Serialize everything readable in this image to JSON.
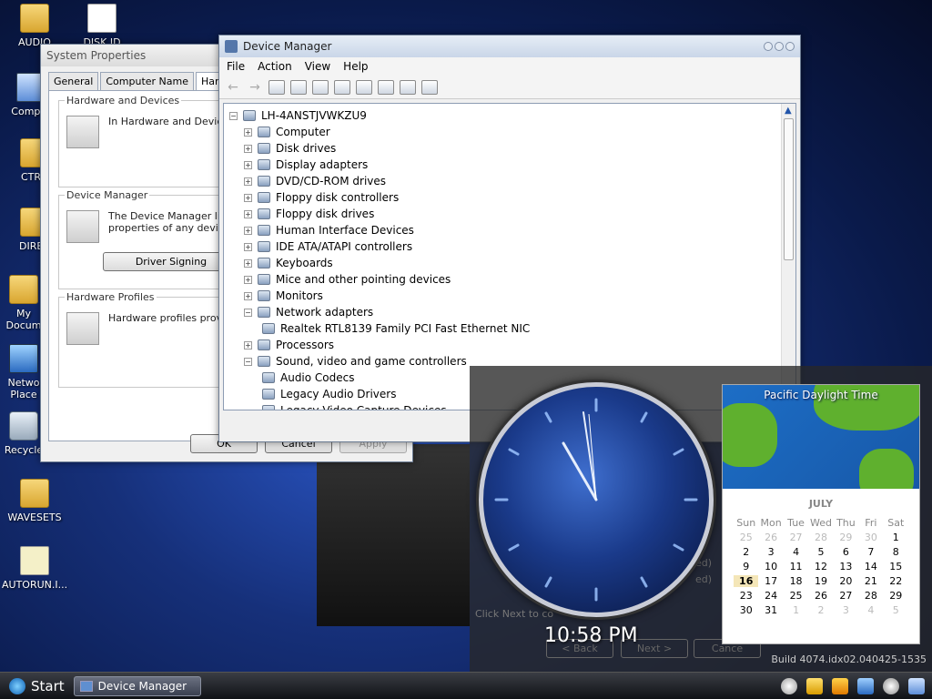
{
  "desktop": {
    "icons": [
      {
        "label": "AUDIO",
        "type": "folder"
      },
      {
        "label": "DISK ID",
        "type": "doc"
      },
      {
        "label": "Comput",
        "type": "computer"
      },
      {
        "label": "CTRU",
        "type": "folder"
      },
      {
        "label": "DIREC",
        "type": "folder"
      },
      {
        "label": "My Docum",
        "type": "folder"
      },
      {
        "label": "Netwo Place",
        "type": "network"
      },
      {
        "label": "Recycle",
        "type": "recycle"
      },
      {
        "label": "WAVESETS",
        "type": "folder"
      },
      {
        "label": "AUTORUN.I...",
        "type": "doc"
      }
    ]
  },
  "system_properties": {
    "title": "System Properties",
    "tabs": [
      "General",
      "Computer Name",
      "Hardwar"
    ],
    "groups": {
      "hardware_devices": {
        "label": "Hardware and Devices",
        "text": "In Hardware and Device to this computer."
      },
      "device_manager": {
        "label": "Device Manager",
        "text": "The Device Manager lis on your computer. Use properties of any device",
        "button": "Driver Signing"
      },
      "hardware_profiles": {
        "label": "Hardware Profiles",
        "text": "Hardware profiles provi different hardware conf"
      }
    },
    "buttons": {
      "ok": "OK",
      "cancel": "Cancel",
      "apply": "Apply"
    }
  },
  "device_manager": {
    "title": "Device Manager",
    "menu": [
      "File",
      "Action",
      "View",
      "Help"
    ],
    "root": "LH-4ANSTJVWKZU9",
    "tree": [
      {
        "label": "Computer",
        "expanded": false,
        "level": 1
      },
      {
        "label": "Disk drives",
        "expanded": false,
        "level": 1
      },
      {
        "label": "Display adapters",
        "expanded": false,
        "level": 1
      },
      {
        "label": "DVD/CD-ROM drives",
        "expanded": false,
        "level": 1
      },
      {
        "label": "Floppy disk controllers",
        "expanded": false,
        "level": 1
      },
      {
        "label": "Floppy disk drives",
        "expanded": false,
        "level": 1
      },
      {
        "label": "Human Interface Devices",
        "expanded": false,
        "level": 1
      },
      {
        "label": "IDE ATA/ATAPI controllers",
        "expanded": false,
        "level": 1
      },
      {
        "label": "Keyboards",
        "expanded": false,
        "level": 1
      },
      {
        "label": "Mice and other pointing devices",
        "expanded": false,
        "level": 1
      },
      {
        "label": "Monitors",
        "expanded": false,
        "level": 1
      },
      {
        "label": "Network adapters",
        "expanded": true,
        "level": 1
      },
      {
        "label": "Realtek RTL8139 Family PCI Fast Ethernet NIC",
        "level": 2
      },
      {
        "label": "Processors",
        "expanded": false,
        "level": 1
      },
      {
        "label": "Sound, video and game controllers",
        "expanded": true,
        "level": 1
      },
      {
        "label": "Audio Codecs",
        "level": 2
      },
      {
        "label": "Legacy Audio Drivers",
        "level": 2
      },
      {
        "label": "Legacy Video Capture Devices",
        "level": 2
      }
    ]
  },
  "gadgets": {
    "clock_time": "10:58 PM",
    "calendar": {
      "timezone": "Pacific Daylight Time",
      "month": "JULY",
      "weekdays": [
        "Sun",
        "Mon",
        "Tue",
        "Wed",
        "Thu",
        "Fri",
        "Sat"
      ],
      "days": [
        [
          "25",
          "26",
          "27",
          "28",
          "29",
          "30",
          "1"
        ],
        [
          "2",
          "3",
          "4",
          "5",
          "6",
          "7",
          "8"
        ],
        [
          "9",
          "10",
          "11",
          "12",
          "13",
          "14",
          "15"
        ],
        [
          "16",
          "17",
          "18",
          "19",
          "20",
          "21",
          "22"
        ],
        [
          "23",
          "24",
          "25",
          "26",
          "27",
          "28",
          "29"
        ],
        [
          "30",
          "31",
          "1",
          "2",
          "3",
          "4",
          "5"
        ]
      ],
      "today": "16"
    },
    "build": "Build 4074.idx02.040425-1535"
  },
  "wizard_remnants": {
    "next_hint": "Click Next to co",
    "back": "< Back",
    "next": "Next >",
    "cancel": "Cance",
    "opt1": "ed)",
    "opt2": "ed)"
  },
  "taskbar": {
    "start_label": "Start",
    "task": "Device Manager"
  }
}
